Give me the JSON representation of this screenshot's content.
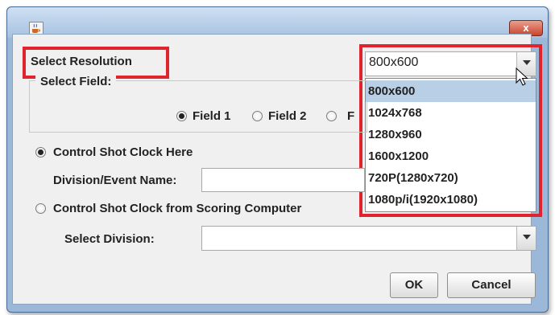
{
  "window": {
    "close_glyph": "x",
    "icon": "java-cup-icon"
  },
  "resolution": {
    "label": "Select Resolution",
    "selected": "800x600",
    "options": [
      "800x600",
      "1024x768",
      "1280x960",
      "1600x1200",
      "720P(1280x720)",
      "1080p/i(1920x1080)"
    ]
  },
  "field_group": {
    "title": "Select Field:",
    "options": [
      "Field 1",
      "Field 2",
      "F"
    ],
    "selected_index": 0
  },
  "control_here": {
    "label": "Control Shot Clock Here",
    "selected": true,
    "division_label": "Division/Event Name:",
    "division_value": ""
  },
  "control_scoring": {
    "label": "Control Shot Clock from Scoring Computer",
    "selected": false,
    "division_label": "Select Division:",
    "division_value": ""
  },
  "buttons": {
    "ok": "OK",
    "cancel": "Cancel"
  },
  "colors": {
    "highlight": "#e0242e",
    "selection": "#b8cfe5",
    "titlebar": "#a6c1e0",
    "close": "#c9432c"
  }
}
